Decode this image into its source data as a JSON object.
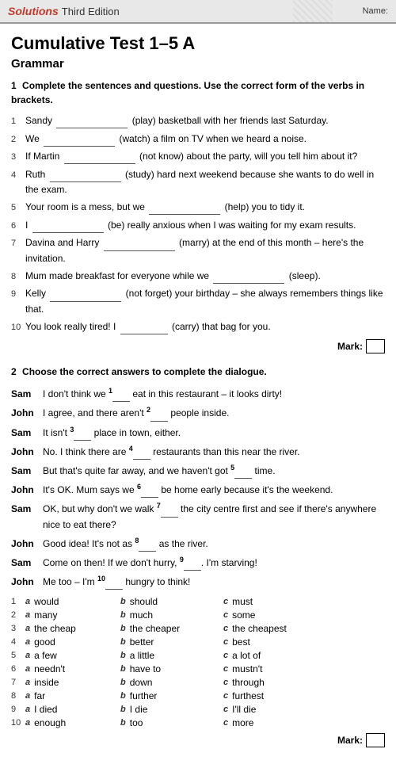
{
  "header": {
    "solutions_label": "Solutions",
    "edition_label": "Third Edition",
    "name_label": "Name:"
  },
  "test": {
    "title": "Cumulative Test 1–5 A",
    "section": "Grammar",
    "q1": {
      "number": "1",
      "instruction_plain": "Complete the sentences and questions. Use the correct form of the verbs in brackets.",
      "sentences": [
        {
          "num": "1",
          "text_before": "Sandy",
          "blank": true,
          "text_after": "(play) basketball with her friends last Saturday."
        },
        {
          "num": "2",
          "text_before": "We",
          "blank": true,
          "text_after": "(watch) a film on TV when we heard a noise."
        },
        {
          "num": "3",
          "text_before": "If Martin",
          "blank": true,
          "text_after": "(not know) about the party, will you tell him about it?"
        },
        {
          "num": "4",
          "text_before": "Ruth",
          "blank": true,
          "text_after": "(study) hard next weekend because she wants to do well in the exam."
        },
        {
          "num": "5",
          "text_before": "Your room is a mess, but we",
          "blank": true,
          "text_after": "(help) you to tidy it."
        },
        {
          "num": "6",
          "text_before": "I",
          "blank": true,
          "text_after": "(be) really anxious when I was waiting for my exam results."
        },
        {
          "num": "7",
          "text_before": "Davina and Harry",
          "blank": true,
          "text_after": "(marry) at the end of this month – here's the invitation."
        },
        {
          "num": "8",
          "text_before": "Mum made breakfast for everyone while we",
          "blank": true,
          "text_after": "(sleep)."
        },
        {
          "num": "9",
          "text_before": "Kelly",
          "blank": true,
          "text_after": "(not forget) your birthday – she always remembers things like that."
        },
        {
          "num": "10",
          "text_before": "You look really tired! I",
          "blank": true,
          "text_after": "(carry) that bag for you."
        }
      ],
      "mark_label": "Mark:"
    },
    "q2": {
      "number": "2",
      "instruction": "Choose the correct answers to complete the dialogue.",
      "dialogue": [
        {
          "speaker": "Sam",
          "text_before": "I don't think we",
          "sup": "1",
          "blank": true,
          "text_after": "eat in this restaurant – it looks dirty!"
        },
        {
          "speaker": "John",
          "text_before": "I agree, and there aren't",
          "sup": "2",
          "blank": true,
          "text_after": "people inside."
        },
        {
          "speaker": "Sam",
          "text_before": "It isn't",
          "sup": "3",
          "blank": true,
          "text_after": "place in town, either."
        },
        {
          "speaker": "John",
          "text_before": "No. I think there are",
          "sup": "4",
          "blank": true,
          "text_after": "restaurants than this near the river."
        },
        {
          "speaker": "Sam",
          "text_before": "But that's quite far away, and we haven't got",
          "sup": "5",
          "blank": true,
          "text_after": "time."
        },
        {
          "speaker": "John",
          "text_before": "It's OK. Mum says we",
          "sup": "6",
          "blank": true,
          "text_after": "be home early because it's the weekend."
        },
        {
          "speaker": "Sam",
          "text_before": "OK, but why don't we walk",
          "sup": "7",
          "blank": true,
          "text_after": "the city centre first and see if there's anywhere nice to eat there?"
        },
        {
          "speaker": "John",
          "text_before": "Good idea! It's not as",
          "sup": "8",
          "blank": true,
          "text_after": "as the river."
        },
        {
          "speaker": "Sam",
          "text_before": "Come on then! If we don't hurry,",
          "sup": "9",
          "blank": true,
          "text_after": ". I'm starving!"
        },
        {
          "speaker": "John",
          "text_before": "Me too – I'm",
          "sup": "10",
          "blank": true,
          "text_after": "hungry to think!"
        }
      ],
      "choices": [
        {
          "num": "1",
          "a": "would",
          "b": "should",
          "c": "must"
        },
        {
          "num": "2",
          "a": "many",
          "b": "much",
          "c": "some"
        },
        {
          "num": "3",
          "a": "the cheap",
          "b": "the cheaper",
          "c": "the cheapest"
        },
        {
          "num": "4",
          "a": "good",
          "b": "better",
          "c": "best"
        },
        {
          "num": "5",
          "a": "a few",
          "b": "a little",
          "c": "a lot of"
        },
        {
          "num": "6",
          "a": "needn't",
          "b": "have to",
          "c": "mustn't"
        },
        {
          "num": "7",
          "a": "inside",
          "b": "down",
          "c": "through"
        },
        {
          "num": "8",
          "a": "far",
          "b": "further",
          "c": "furthest"
        },
        {
          "num": "9",
          "a": "I died",
          "b": "I die",
          "c": "I'll die"
        },
        {
          "num": "10",
          "a": "enough",
          "b": "too",
          "c": "more"
        }
      ],
      "mark_label": "Mark:"
    }
  }
}
